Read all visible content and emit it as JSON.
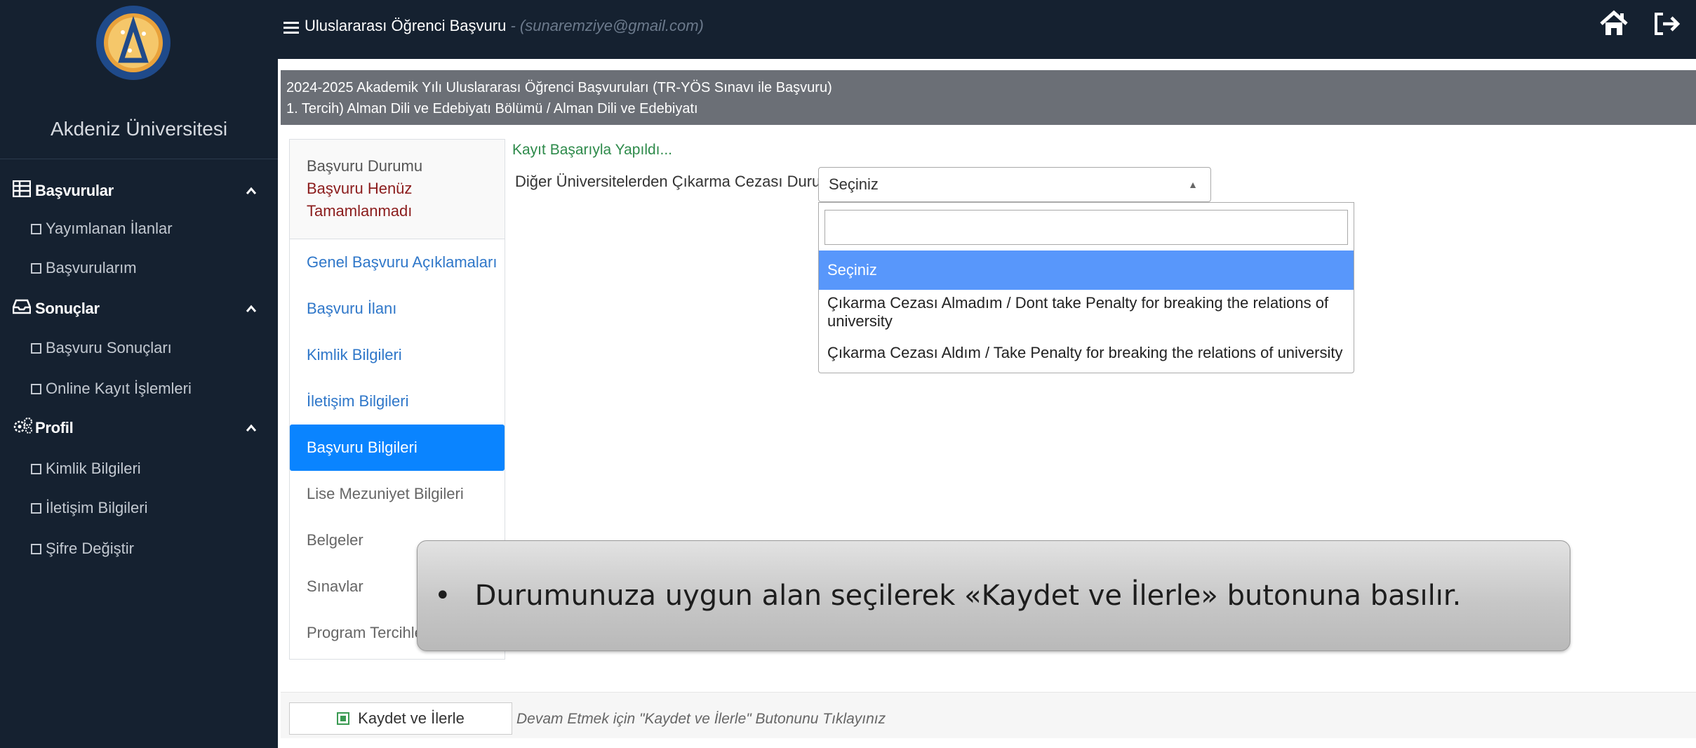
{
  "sidebar": {
    "university_name": "Akdeniz Üniversitesi",
    "logo_icon": "university-seal-icon",
    "sections": [
      {
        "label": "Başvurular",
        "icon": "table-icon",
        "items": [
          "Yayımlanan İlanlar",
          "Başvurularım"
        ]
      },
      {
        "label": "Sonuçlar",
        "icon": "inbox-icon",
        "items": [
          "Başvuru Sonuçları",
          "Online Kayıt İşlemleri"
        ]
      },
      {
        "label": "Profil",
        "icon": "gears-icon",
        "items": [
          "Kimlik Bilgileri",
          "İletişim Bilgileri",
          "Şifre Değiştir"
        ]
      }
    ]
  },
  "topbar": {
    "title": "Uluslararası Öğrenci Başvuru",
    "email": " - (sunaremziye@gmail.com)"
  },
  "header": {
    "line1": "2024-2025 Akademik Yılı Uluslararası Öğrenci Başvuruları (TR-YÖS Sınavı ile Başvuru)",
    "line2": "1. Tercih) Alman Dili ve Edebiyatı Bölümü / Alman Dili ve Edebiyatı"
  },
  "status": {
    "label": "Başvuru Durumu",
    "value": "Başvuru Henüz Tamamlanmadı"
  },
  "tabs": [
    "Genel Başvuru Açıklamaları",
    "Başvuru İlanı",
    "Kimlik Bilgileri",
    "İletişim Bilgileri",
    "Başvuru Bilgileri",
    "Lise Mezuniyet Bilgileri",
    "Belgeler",
    "Sınavlar",
    "Program Tercihleri"
  ],
  "form": {
    "success_message": "Kayıt Başarıyla Yapıldı...",
    "field_label": "Diğer Üniversitelerden Çıkarma Cezası Durumu",
    "selected_value": "Seçiniz",
    "options": [
      "Seçiniz",
      "Çıkarma Cezası Almadım / Dont take Penalty for breaking the relations of university",
      "Çıkarma Cezası Aldım / Take Penalty for breaking the relations of university"
    ]
  },
  "callout": {
    "bullet": "•",
    "text": "Durumunuza uygun alan seçilerek «Kaydet ve İlerle» butonuna basılır."
  },
  "footer": {
    "save_label": "Kaydet ve İlerle",
    "hint": "Devam Etmek için \"Kaydet ve İlerle\" Butonunu Tıklayınız"
  }
}
